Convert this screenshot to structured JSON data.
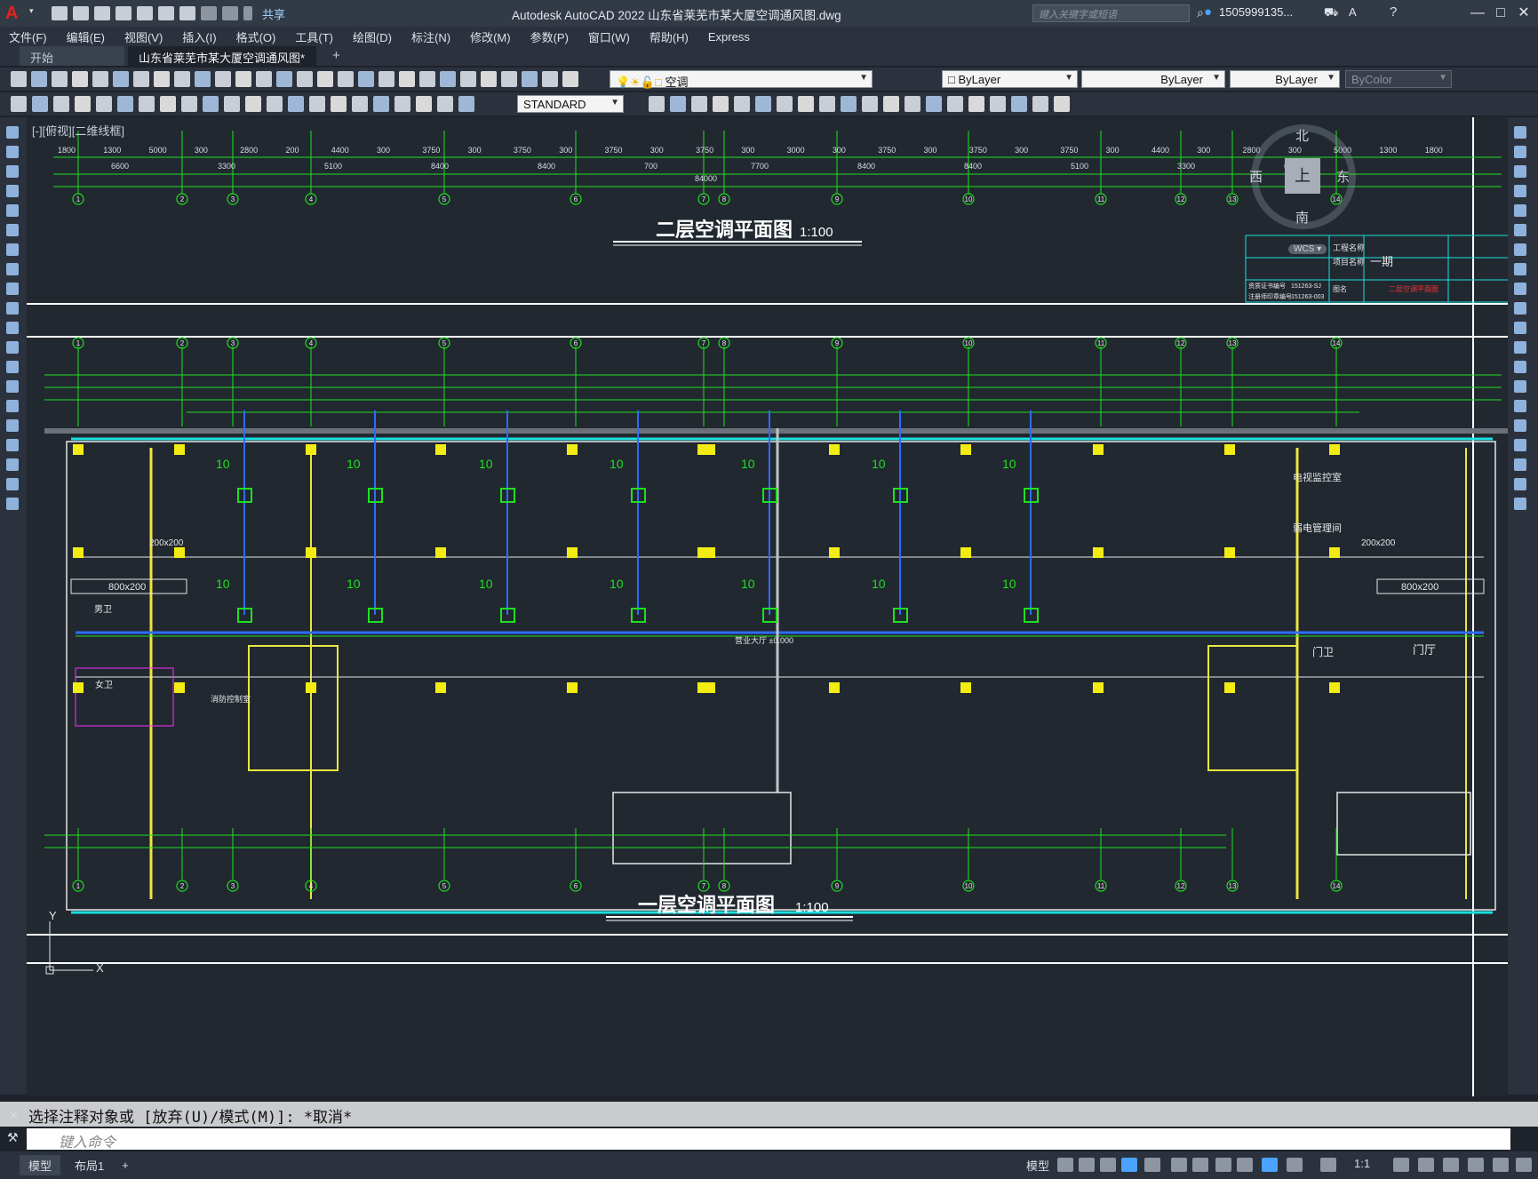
{
  "app": {
    "title": "Autodesk AutoCAD 2022    山东省莱芜市某大厦空调通风图.dwg",
    "search_placeholder": "键入关键字或短语",
    "user": "1505999135...",
    "share_label": "共享"
  },
  "menu": [
    "文件(F)",
    "编辑(E)",
    "视图(V)",
    "插入(I)",
    "格式(O)",
    "工具(T)",
    "绘图(D)",
    "标注(N)",
    "修改(M)",
    "参数(P)",
    "窗口(W)",
    "帮助(H)",
    "Express"
  ],
  "tabs": {
    "start": "开始",
    "doc": "山东省莱芜市某大厦空调通风图*"
  },
  "toolbar": {
    "layer": "空调",
    "color": "ByLayer",
    "linetype": "ByLayer",
    "lineweight": "ByLayer",
    "plotstyle": "ByColor",
    "textstyle": "STANDARD"
  },
  "viewport": {
    "label": "[-][俯视][二维线框]"
  },
  "viewcube": {
    "north": "北",
    "south": "南",
    "east": "东",
    "west": "西",
    "top": "上",
    "wcs": "WCS"
  },
  "drawing": {
    "plan2_title": "二层空调平面图",
    "plan1_title": "一层空调平面图",
    "scale": "1:100",
    "rooms": [
      "电视监控室",
      "弱电管理间",
      "营业大厅",
      "男卫",
      "女卫",
      "消防控制室",
      "门卫",
      "门厅"
    ],
    "rooms_label": "营业大厅 ±0.000",
    "duct": "800x200",
    "duct2": "200x200",
    "diffuser_tag": "10",
    "axis_labels": [
      "1",
      "2",
      "3",
      "4",
      "5",
      "6",
      "7",
      "8",
      "9",
      "10",
      "11",
      "12",
      "13",
      "14"
    ],
    "dims_top": [
      "1800",
      "1300",
      "5000",
      "300",
      "2800",
      "200",
      "4400",
      "300",
      "3750",
      "300",
      "3750",
      "300",
      "3750",
      "300",
      "3750",
      "300",
      "3000",
      "300",
      "3750",
      "300",
      "3750",
      "300",
      "3750",
      "300",
      "4400",
      "300",
      "2800",
      "300",
      "5000",
      "1300",
      "1800"
    ],
    "dims_mid": [
      "6600",
      "3300",
      "5100",
      "8400",
      "8400",
      "700",
      "7700",
      "8400",
      "8400",
      "5100",
      "3300",
      "6600"
    ],
    "total": "84000",
    "titleblock": {
      "row1": "工程名称",
      "row2": "项目名称",
      "value": "一期",
      "a": "资质证书编号",
      "b": "注册师印章编号",
      "code1": "151263-SJ",
      "code2": "151263-003",
      "fig": "图名",
      "figname": "二层空调平面图"
    }
  },
  "command": {
    "history": "选择注释对象或 [放弃(U)/模式(M)]: *取消*",
    "placeholder": "键入命令"
  },
  "status": {
    "model_tab": "模型",
    "layout_tab": "布局1",
    "model_btn": "模型",
    "scale": "1:1"
  }
}
